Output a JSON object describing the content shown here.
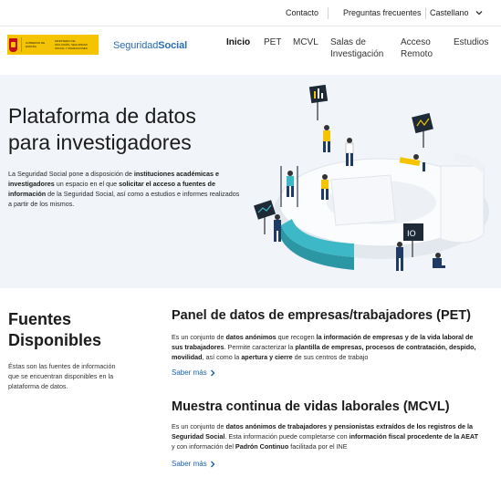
{
  "topbar": {
    "contacto": "Contacto",
    "preguntas": "Preguntas frecuentes",
    "language": "Castellano"
  },
  "header": {
    "gov_logo_text_1": "GOBIERNO DE ESPAÑA",
    "gov_logo_text_2": "MINISTERIO DE INCLUSIÓN, SEGURIDAD SOCIAL Y MIGRACIONES",
    "brand_light": "Seguridad",
    "brand_bold": "Social",
    "nav": [
      {
        "line1": "Inicio",
        "line2": ""
      },
      {
        "line1": "PET",
        "line2": ""
      },
      {
        "line1": "MCVL",
        "line2": ""
      },
      {
        "line1": "Salas de",
        "line2": "Investigación"
      },
      {
        "line1": "Acceso",
        "line2": "Remoto"
      },
      {
        "line1": "Estudios",
        "line2": ""
      }
    ]
  },
  "hero": {
    "title_line1": "Plataforma de datos",
    "title_line2": "para investigadores",
    "p1": "La Seguridad Social pone a disposición de ",
    "b1": "instituciones académicas e investigadores",
    "p2": " un espacio en el que ",
    "b2": "solicitar el acceso a fuentes de información",
    "p3": " de la Seguridad Social, así como a estudios e informes realizados a partir de los mismos."
  },
  "fuentes": {
    "title_line1": "Fuentes",
    "title_line2": "Disponibles",
    "text": "Éstas son las fuentes de información que se encuentran disponibles en la plataforma de datos."
  },
  "pet": {
    "title": "Panel de datos de empresas/trabajadores (PET)",
    "t1": "Es un conjunto de ",
    "b1": "datos anónimos",
    "t2": " que recogen ",
    "b2": "la información de empresas y de la vida laboral de sus trabajadores",
    "t3": ". Permite caracterizar la ",
    "b3": "plantilla de empresas, procesos de contratación, despido, movilidad",
    "t4": ", así como la ",
    "b4": "apertura y cierre",
    "t5": " de sus centros de trabajo",
    "more": "Saber más"
  },
  "mcvl": {
    "title": "Muestra continua de vidas laborales (MCVL)",
    "t1": "Es un conjunto de ",
    "b1": "datos anónimos de trabajadores y pensionistas extraídos de los registros de la Seguridad Social",
    "t2": ". Esta información puede completarse con ",
    "b2": "información fiscal procedente de la AEAT",
    "t3": " y con información del ",
    "b3": "Padrón Continuo",
    "t4": " facilitada por el INE",
    "more": "Saber más"
  },
  "colors": {
    "accent": "#1a5fb4",
    "hero_bg": "#f1f4f8",
    "teal": "#3db8c6",
    "gov_yellow": "#f5c400"
  }
}
